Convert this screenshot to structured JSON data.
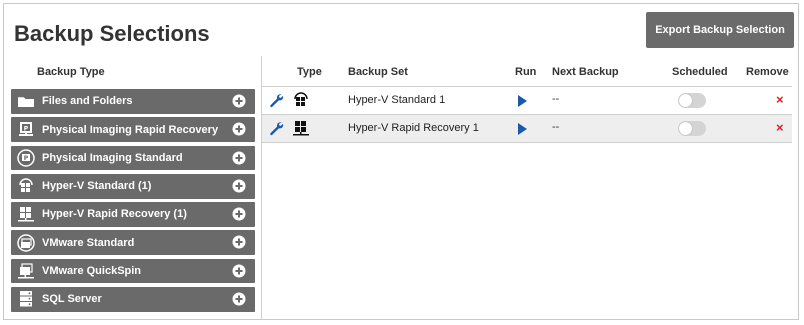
{
  "page": {
    "title": "Backup Selections",
    "export_button": "Export Backup Selection"
  },
  "backup_types": {
    "header": "Backup Type",
    "items": [
      {
        "label": "Files and Folders",
        "icon": "folder-icon"
      },
      {
        "label": "Physical Imaging Rapid Recovery",
        "icon": "physical-rapid-icon"
      },
      {
        "label": "Physical Imaging Standard",
        "icon": "physical-standard-icon"
      },
      {
        "label": "Hyper-V Standard (1)",
        "icon": "hyperv-standard-icon"
      },
      {
        "label": "Hyper-V Rapid Recovery (1)",
        "icon": "hyperv-rapid-icon"
      },
      {
        "label": "VMware Standard",
        "icon": "vmware-standard-icon"
      },
      {
        "label": "VMware QuickSpin",
        "icon": "vmware-quickspin-icon"
      },
      {
        "label": "SQL Server",
        "icon": "sql-server-icon"
      }
    ]
  },
  "table": {
    "columns": {
      "type": "Type",
      "backup_set": "Backup Set",
      "run": "Run",
      "next_backup": "Next Backup",
      "scheduled": "Scheduled",
      "remove": "Remove"
    },
    "rows": [
      {
        "type_icon": "hyperv-standard-icon",
        "backup_set": "Hyper-V Standard 1",
        "next_backup": "--",
        "scheduled": false,
        "remove": "×"
      },
      {
        "type_icon": "hyperv-rapid-icon",
        "backup_set": "Hyper-V Rapid Recovery 1",
        "next_backup": "--",
        "scheduled": false,
        "remove": "×"
      }
    ]
  },
  "colors": {
    "accent_blue": "#1a5aa8",
    "remove_red": "#e02020",
    "panel_gray": "#6a6a6a"
  }
}
